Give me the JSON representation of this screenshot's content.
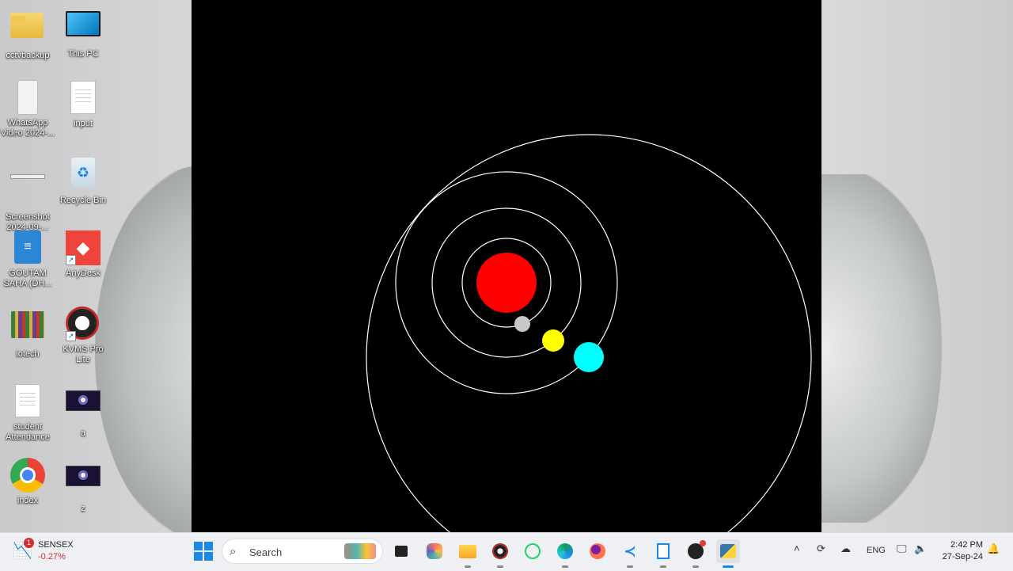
{
  "desktop": {
    "icons": [
      {
        "label": "cctvbackup",
        "icon": "folder-icon"
      },
      {
        "label": "This PC",
        "icon": "computer-icon"
      },
      {
        "label": "WhatsApp Video 2024-...",
        "icon": "video-file-icon"
      },
      {
        "label": "input",
        "icon": "text-file-icon"
      },
      {
        "label": "Screenshot 2024-09-...",
        "icon": "image-file-icon"
      },
      {
        "label": "Recycle Bin",
        "icon": "recycle-bin-icon"
      },
      {
        "label": "GOUTAM SAHA (DH...",
        "icon": "document-icon"
      },
      {
        "label": "AnyDesk",
        "icon": "anydesk-icon"
      },
      {
        "label": "iotech",
        "icon": "books-folder-icon"
      },
      {
        "label": "KVMS Pro Lite",
        "icon": "kvms-icon"
      },
      {
        "label": "student Attendance",
        "icon": "text-file-icon"
      },
      {
        "label": "a",
        "icon": "video-thumbnail-icon"
      },
      {
        "label": "index",
        "icon": "chrome-icon"
      },
      {
        "label": "z",
        "icon": "video-thumbnail-icon"
      }
    ]
  },
  "simulation": {
    "background": "#000000",
    "orbit_color": "#ffffff",
    "sun_color": "#ff0000",
    "planet_colors": [
      "#c8c8c8",
      "#ffff00",
      "#00ffff"
    ]
  },
  "taskbar": {
    "widget": {
      "title": "SENSEX",
      "value": "-0.27%",
      "badge": "1",
      "icon": "stock-chart-icon"
    },
    "search": {
      "placeholder": "Search"
    },
    "apps": [
      {
        "name": "task-view",
        "icon": "task-view-icon"
      },
      {
        "name": "copilot",
        "icon": "copilot-icon"
      },
      {
        "name": "file-explorer",
        "icon": "folder-icon"
      },
      {
        "name": "kvms",
        "icon": "eye-icon"
      },
      {
        "name": "whatsapp",
        "icon": "whatsapp-icon"
      },
      {
        "name": "edge",
        "icon": "edge-icon"
      },
      {
        "name": "firefox",
        "icon": "firefox-icon"
      },
      {
        "name": "vscode",
        "icon": "vscode-icon"
      },
      {
        "name": "notepad",
        "icon": "notepad-icon"
      },
      {
        "name": "obs",
        "icon": "record-icon"
      },
      {
        "name": "python",
        "icon": "python-icon"
      }
    ],
    "tray": {
      "language": "ENG",
      "time": "2:42 PM",
      "date": "27-Sep-24"
    }
  }
}
